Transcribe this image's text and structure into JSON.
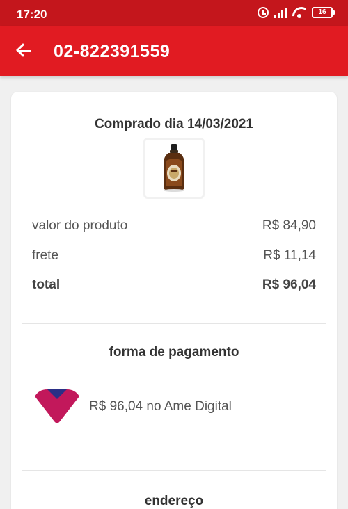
{
  "status_bar": {
    "time": "17:20",
    "battery": "16"
  },
  "header": {
    "title": "02-822391559"
  },
  "order": {
    "purchase_date": "Comprado dia 14/03/2021",
    "lines": [
      {
        "label": "valor do produto",
        "value": "R$ 84,90"
      },
      {
        "label": "frete",
        "value": "R$ 11,14"
      },
      {
        "label": "total",
        "value": "R$ 96,04"
      }
    ]
  },
  "payment": {
    "title": "forma de pagamento",
    "description": "R$ 96,04 no Ame Digital",
    "icon": "ame-digital-logo-icon"
  },
  "address": {
    "title": "endereço"
  },
  "colors": {
    "status_bar": "#c4161c",
    "app_bar": "#e11b22",
    "background": "#f0f0f0",
    "ame_magenta": "#c2185b",
    "ame_blue": "#2b2f86"
  }
}
